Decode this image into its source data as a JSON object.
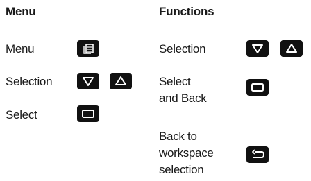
{
  "columns": {
    "left": {
      "heading": "Menu"
    },
    "right": {
      "heading": "Functions"
    }
  },
  "menu_rows": [
    {
      "label": "Menu",
      "keys": [
        "menu-icon"
      ]
    },
    {
      "label": "Selection",
      "keys": [
        "triangle-down-icon",
        "triangle-up-icon"
      ]
    },
    {
      "label": "Select",
      "keys": [
        "select-rectangle-icon"
      ]
    }
  ],
  "function_rows": [
    {
      "label": "Selection",
      "keys": [
        "triangle-down-icon",
        "triangle-up-icon"
      ]
    },
    {
      "label": "Select\nand Back",
      "keys": [
        "select-rectangle-icon"
      ]
    },
    {
      "label": "Back to\nworkspace\nselection",
      "keys": [
        "back-return-icon"
      ]
    }
  ],
  "colors": {
    "key_background": "#111111",
    "key_symbol": "#ffffff",
    "text": "#1a1a1a"
  }
}
